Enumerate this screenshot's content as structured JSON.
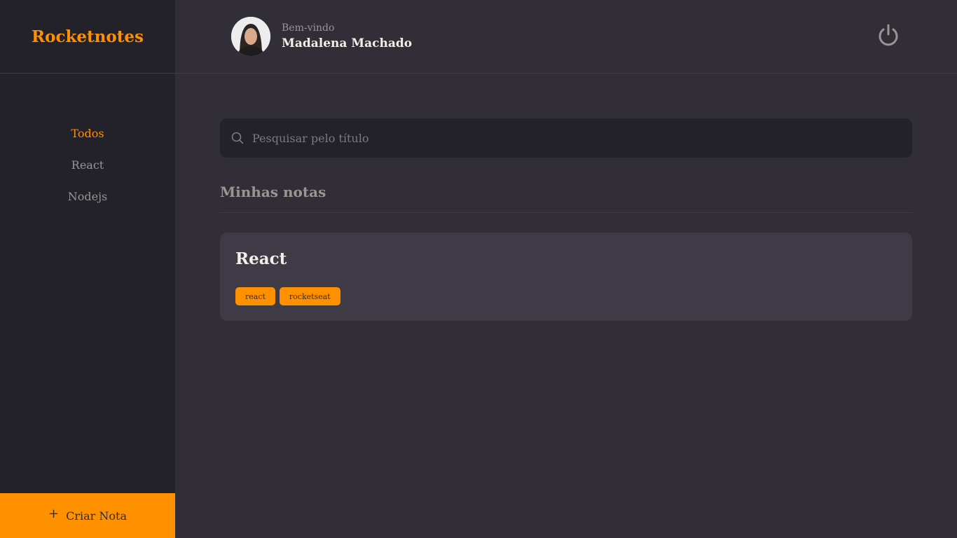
{
  "brand": {
    "title": "Rocketnotes"
  },
  "sidebar": {
    "items": [
      {
        "label": "Todos",
        "active": true
      },
      {
        "label": "React",
        "active": false
      },
      {
        "label": "Nodejs",
        "active": false
      }
    ],
    "create_label": "Criar Nota",
    "create_icon": "plus-icon"
  },
  "header": {
    "welcome": "Bem-vindo",
    "user_name": "Madalena Machado",
    "signout_icon": "power-icon"
  },
  "search": {
    "placeholder": "Pesquisar pelo título",
    "value": "",
    "icon": "search-icon"
  },
  "notes_section": {
    "title": "Minhas notas",
    "notes": [
      {
        "title": "React",
        "tags": [
          "react",
          "rocketseat"
        ]
      }
    ]
  },
  "colors": {
    "accent": "#FF9000",
    "background": "#312E38",
    "sidebar": "#232129",
    "card": "#3E3B47",
    "text": "#F4EDE8",
    "muted": "#999591"
  }
}
